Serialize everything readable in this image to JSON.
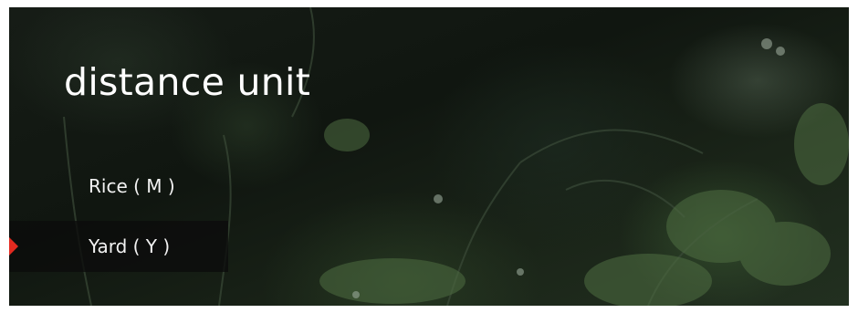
{
  "screen": {
    "title": "distance unit"
  },
  "menu": {
    "items": [
      {
        "label": "Rice ( M )",
        "selected": false
      },
      {
        "label": "Yard ( Y )",
        "selected": true
      }
    ]
  },
  "colors": {
    "selection_marker": "#e32a20",
    "selected_row_bg": "#0c0c0c",
    "text": "#ffffff"
  },
  "icons": {
    "selection_marker": "triangle-right-icon"
  }
}
